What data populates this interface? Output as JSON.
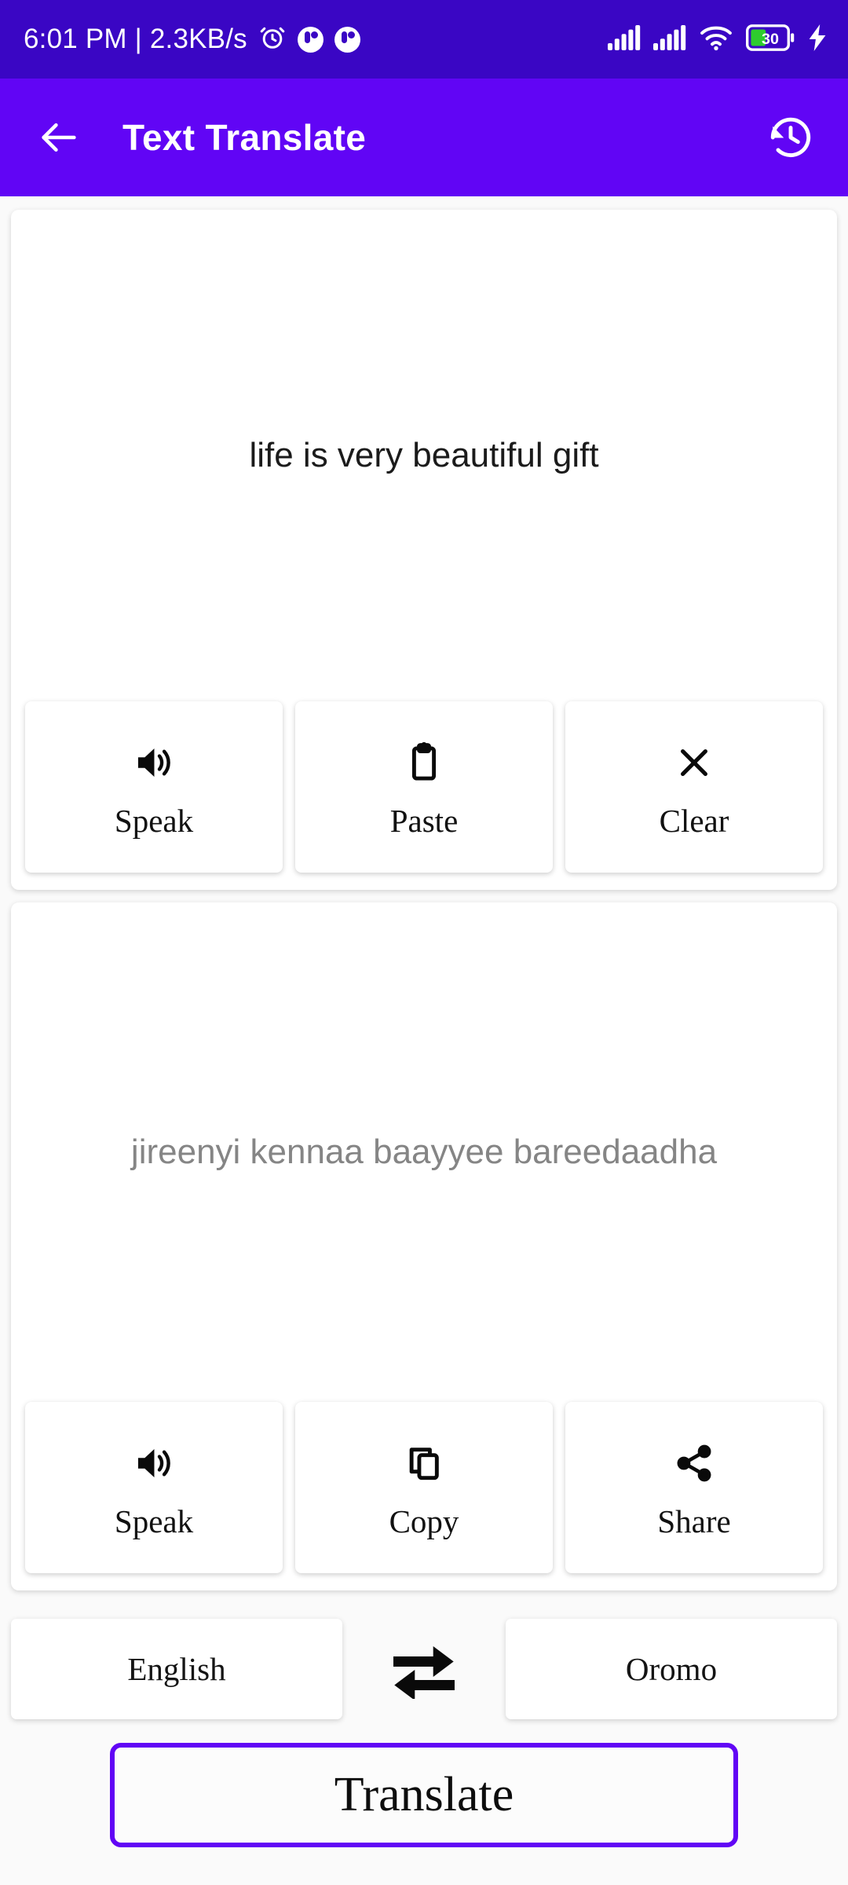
{
  "status_bar": {
    "time": "6:01 PM",
    "separator": "|",
    "network_speed": "2.3KB/s",
    "combined_text": "6:01 PM | 2.3KB/s",
    "alarm_icon": "alarm-clock-icon",
    "notification_icons": [
      "notification-badge-icon",
      "notification-badge-icon"
    ],
    "signal_icons": [
      "signal-bars-icon",
      "signal-bars-icon"
    ],
    "wifi_icon": "wifi-icon",
    "battery_level": "30",
    "charging": true,
    "background_color": "#3A06C4"
  },
  "app_bar": {
    "back_icon": "back-arrow-icon",
    "title": "Text Translate",
    "history_icon": "history-icon",
    "background_color": "#6105F5",
    "text_color": "#FFFFFF"
  },
  "source_card": {
    "text": "life is very beautiful gift",
    "text_color": "#1B1B1B",
    "actions": [
      {
        "label": "Speak",
        "icon": "volume-up-icon"
      },
      {
        "label": "Paste",
        "icon": "clipboard-icon"
      },
      {
        "label": "Clear",
        "icon": "close-x-icon"
      }
    ]
  },
  "target_card": {
    "text": "jireenyi kennaa baayyee bareedaadha",
    "text_color": "#858585",
    "actions": [
      {
        "label": "Speak",
        "icon": "volume-up-icon"
      },
      {
        "label": "Copy",
        "icon": "copy-icon"
      },
      {
        "label": "Share",
        "icon": "share-nodes-icon"
      }
    ]
  },
  "language_selector": {
    "source_language": "English",
    "target_language": "Oromo",
    "swap_icon": "swap-arrows-icon"
  },
  "translate_button": {
    "label": "Translate",
    "border_color": "#6105F5"
  }
}
